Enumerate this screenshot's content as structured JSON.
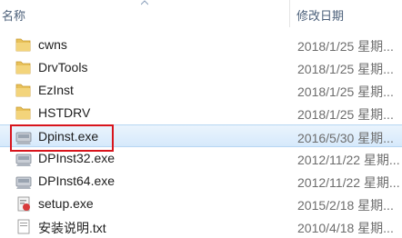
{
  "header": {
    "name_label": "名称",
    "date_label": "修改日期"
  },
  "files": [
    {
      "name": "cwns",
      "date": "2018/1/25 星期...",
      "icon": "folder-icon"
    },
    {
      "name": "DrvTools",
      "date": "2018/1/25 星期...",
      "icon": "folder-icon"
    },
    {
      "name": "EzInst",
      "date": "2018/1/25 星期...",
      "icon": "folder-icon"
    },
    {
      "name": "HSTDRV",
      "date": "2018/1/25 星期...",
      "icon": "folder-icon"
    },
    {
      "name": "Dpinst.exe",
      "date": "2016/5/30 星期...",
      "icon": "installer-exe-icon",
      "selected": true
    },
    {
      "name": "DPInst32.exe",
      "date": "2012/11/22 星期...",
      "icon": "installer-exe-icon"
    },
    {
      "name": "DPInst64.exe",
      "date": "2012/11/22 星期...",
      "icon": "installer-exe-icon"
    },
    {
      "name": "setup.exe",
      "date": "2015/2/18 星期...",
      "icon": "setup-exe-icon"
    },
    {
      "name": "安装说明.txt",
      "date": "2010/4/18 星期...",
      "icon": "text-file-icon"
    }
  ],
  "colors": {
    "selection": "#d6e9fb",
    "highlight_box": "#d8141c",
    "folder": "#e8c15a"
  }
}
